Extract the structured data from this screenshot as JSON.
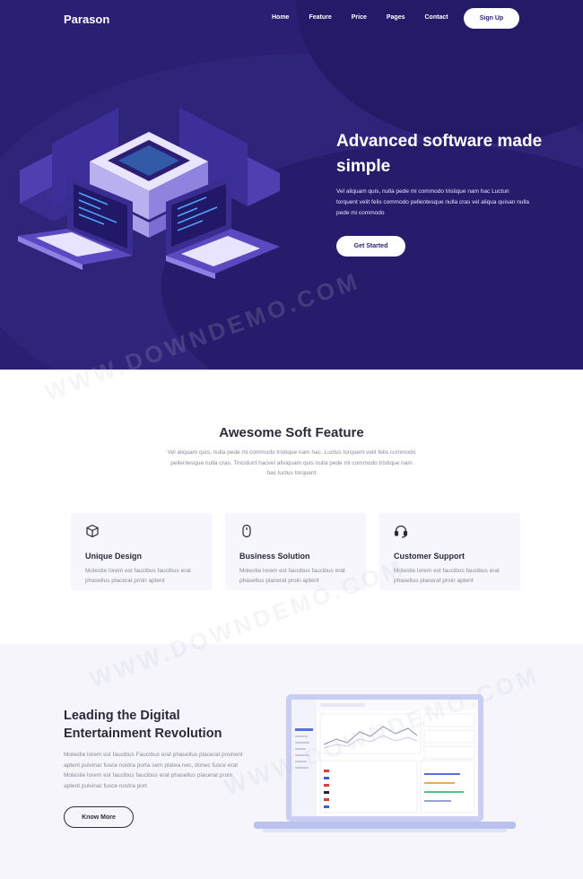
{
  "nav": {
    "logo": "Parason",
    "links": [
      "Home",
      "Feature",
      "Price",
      "Pages",
      "Contact"
    ],
    "signup": "Sign Up"
  },
  "hero": {
    "title": "Advanced software made simple",
    "description": "Vel aliquam quis, nulla pede mi commodo tristique nam hac Luctun torquent velit felis commodo pellentesque nulla cras vel aliqua quisan nulla pede mi commodo",
    "button": "Get Started"
  },
  "features": {
    "title": "Awesome Soft Feature",
    "description": "Vel aliquam quis, nulla pede mi commodo tristique nam hac. Luctus torquent velit felis commodo pellentesque nulla cras. Tincidunt hacvel allviquam quis nulla pede mi commodo tristique nam hac luctus torquent",
    "cards": [
      {
        "icon": "cube-icon",
        "title": "Unique Design",
        "desc": "Molestie lorem est faucibus faucibus erat phasellus placerat proin aptent"
      },
      {
        "icon": "mouse-icon",
        "title": "Business Solution",
        "desc": "Molestie lorem est faucibus faucibus erat phasellus placerat proin aptent"
      },
      {
        "icon": "headset-icon",
        "title": "Customer Support",
        "desc": "Molestie lorem est faucibus faucibus erat phasellus placerat proin aptent"
      }
    ]
  },
  "lead": {
    "title": "Leading the Digital Entertainment Revolution",
    "description": "Molestie lorem est faucibus Faucibus erat phasellus placerat proinent aptent pulvinar fusce nostra porta sem platea nec, donec fusce erat Molestie lorem est faucibus faucibus erat phasellus placerat proin aptent pulvinar fusce nostra port",
    "button": "Know More"
  },
  "watermark": "WWW.DOWNDEMO.COM",
  "colors": {
    "hero_bg": "#2a1f73",
    "accent": "#6c5ce7",
    "card_bg": "#f6f6fc"
  }
}
